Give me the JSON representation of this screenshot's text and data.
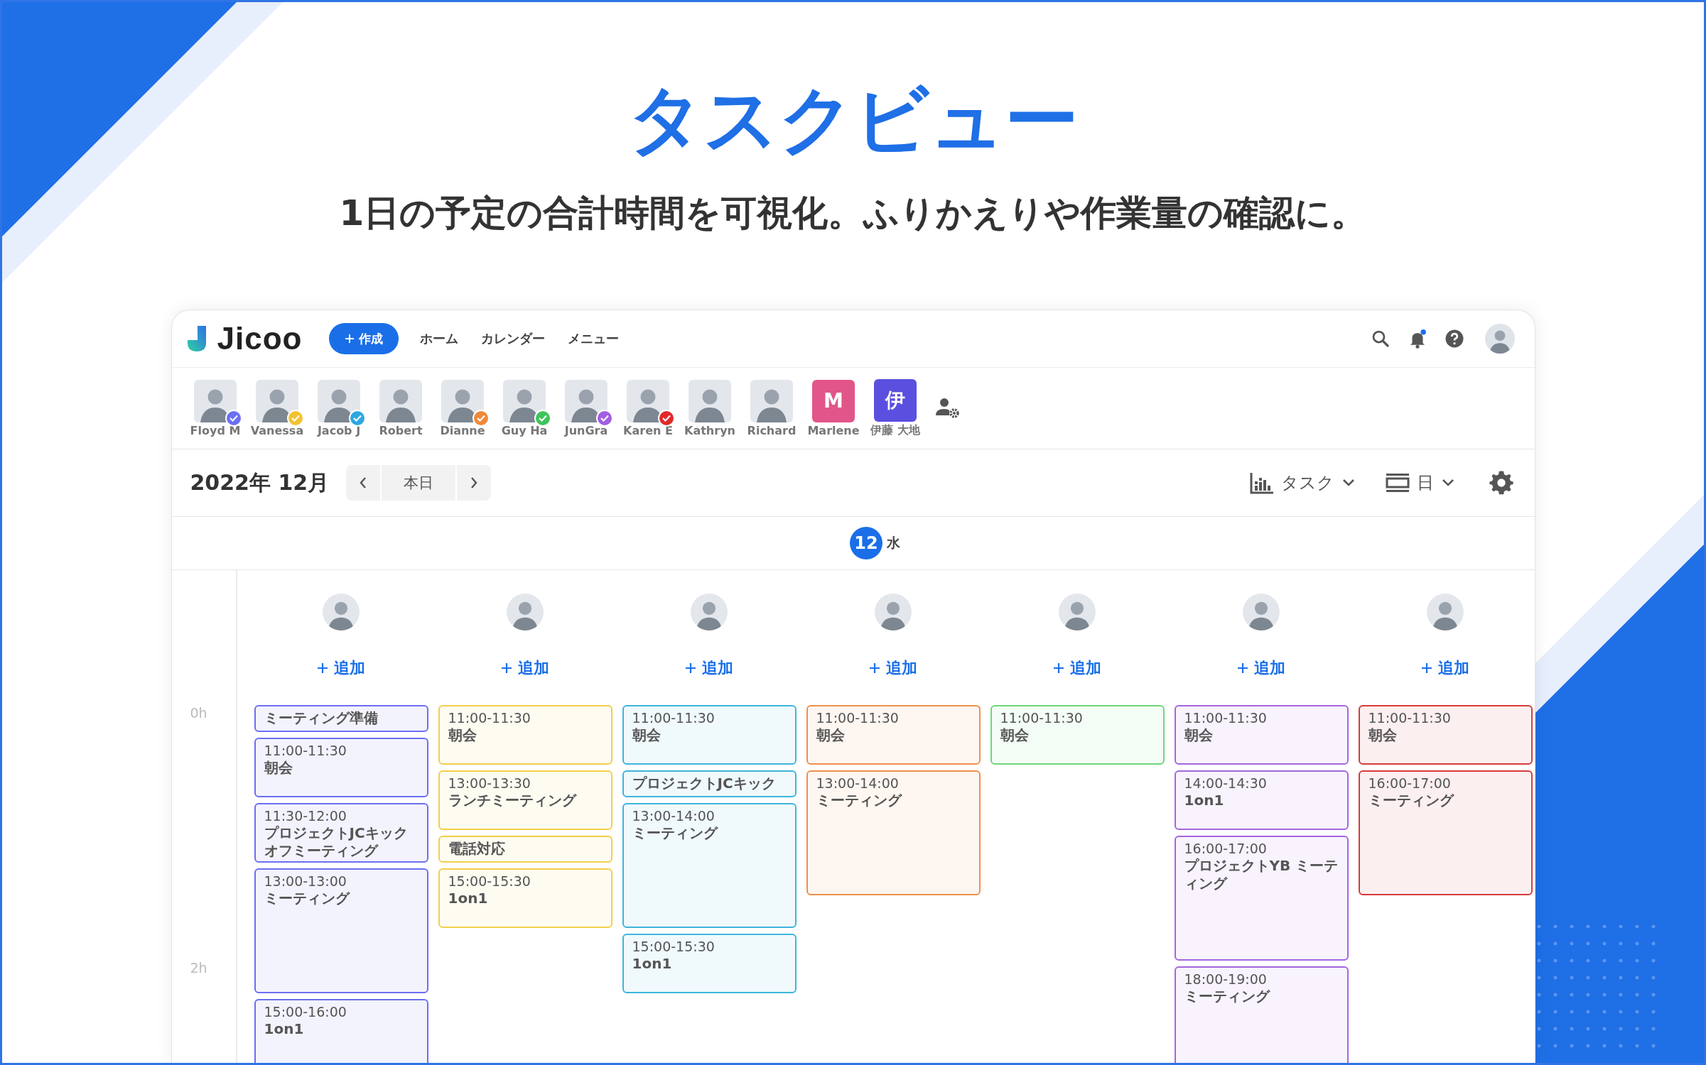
{
  "headline": {
    "title": "タスクビュー",
    "subtitle": "1日の予定の合計時間を可視化。ふりかえりや作業量の確認に。"
  },
  "app": {
    "logo": "Jicoo",
    "create_button": "作成",
    "nav": [
      "ホーム",
      "カレンダー",
      "メニュー"
    ]
  },
  "members": [
    {
      "name": "Floyd M",
      "kind": "photo",
      "color": "#6b6ff2"
    },
    {
      "name": "Vanessa",
      "kind": "photo",
      "color": "#f2c230"
    },
    {
      "name": "Jacob J",
      "kind": "photo",
      "color": "#2ea8e0"
    },
    {
      "name": "Robert",
      "kind": "photo"
    },
    {
      "name": "Dianne",
      "kind": "photo",
      "color": "#f0883a"
    },
    {
      "name": "Guy Ha",
      "kind": "photo",
      "color": "#3ec45a"
    },
    {
      "name": "JunGra",
      "kind": "photo",
      "color": "#a25ee0"
    },
    {
      "name": "Karen E",
      "kind": "photo",
      "color": "#e02a2a"
    },
    {
      "name": "Kathryn",
      "kind": "photo"
    },
    {
      "name": "Richard",
      "kind": "photo"
    },
    {
      "name": "Marlene",
      "kind": "initial",
      "initial": "M",
      "color": "#e2558a"
    },
    {
      "name": "伊藤 大地",
      "kind": "initial",
      "initial": "伊",
      "color": "#5b4fe0"
    }
  ],
  "toolbar": {
    "month": "2022年 12月",
    "today_button": "本日",
    "view_dropdown": "タスク",
    "range_dropdown": "日"
  },
  "day": {
    "date": "12",
    "weekday": "水"
  },
  "time_axis": [
    "0h",
    "2h"
  ],
  "columns": [
    {
      "color": "#6b6ff2",
      "add_label": "追加",
      "events": [
        {
          "kind": "task",
          "title": "ミーティング準備"
        },
        {
          "kind": "half",
          "time": "11:00-11:30",
          "title": "朝会"
        },
        {
          "kind": "half",
          "time": "11:30-12:00",
          "title": "プロジェクトJCキックオフミーティング"
        },
        {
          "kind": "hour",
          "time": "13:00-13:00",
          "title": "ミーティング"
        },
        {
          "kind": "hour",
          "time": "15:00-16:00",
          "title": "1on1"
        }
      ]
    },
    {
      "color": "#f2cf4a",
      "add_label": "追加",
      "events": [
        {
          "kind": "half",
          "time": "11:00-11:30",
          "title": "朝会"
        },
        {
          "kind": "half",
          "time": "13:00-13:30",
          "title": "ランチミーティング"
        },
        {
          "kind": "task",
          "title": "電話対応"
        },
        {
          "kind": "half",
          "time": "15:00-15:30",
          "title": "1on1"
        }
      ]
    },
    {
      "color": "#3fb5dc",
      "add_label": "追加",
      "events": [
        {
          "kind": "half",
          "time": "11:00-11:30",
          "title": "朝会"
        },
        {
          "kind": "task",
          "title": "プロジェクトJCキック"
        },
        {
          "kind": "hour",
          "time": "13:00-14:00",
          "title": "ミーティング"
        },
        {
          "kind": "half",
          "time": "15:00-15:30",
          "title": "1on1"
        }
      ]
    },
    {
      "color": "#f0904a",
      "add_label": "追加",
      "events": [
        {
          "kind": "half",
          "time": "11:00-11:30",
          "title": "朝会"
        },
        {
          "kind": "hour",
          "time": "13:00-14:00",
          "title": "ミーティング"
        }
      ]
    },
    {
      "color": "#6ed67c",
      "add_label": "追加",
      "events": [
        {
          "kind": "half",
          "time": "11:00-11:30",
          "title": "朝会"
        }
      ]
    },
    {
      "color": "#a565e0",
      "add_label": "追加",
      "events": [
        {
          "kind": "half",
          "time": "11:00-11:30",
          "title": "朝会"
        },
        {
          "kind": "half",
          "time": "14:00-14:30",
          "title": "1on1"
        },
        {
          "kind": "hour",
          "time": "16:00-17:00",
          "title": "プロジェクトYB ミーティング"
        },
        {
          "kind": "hour",
          "time": "18:00-19:00",
          "title": "ミーティング"
        }
      ]
    },
    {
      "color": "#d93a3a",
      "add_label": "追加",
      "events": [
        {
          "kind": "half",
          "time": "11:00-11:30",
          "title": "朝会"
        },
        {
          "kind": "hour",
          "time": "16:00-17:00",
          "title": "ミーティング"
        }
      ]
    }
  ]
}
